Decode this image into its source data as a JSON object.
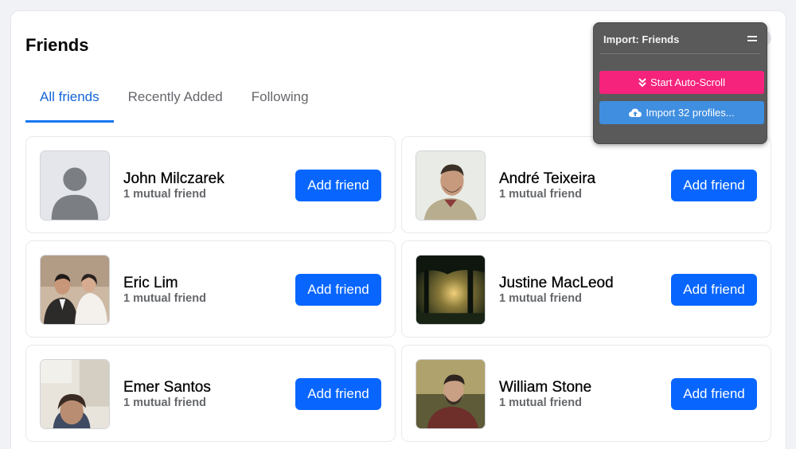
{
  "page": {
    "title": "Friends"
  },
  "tabs": [
    {
      "label": "All friends",
      "active": true
    },
    {
      "label": "Recently Added",
      "active": false
    },
    {
      "label": "Following",
      "active": false
    }
  ],
  "friends": [
    {
      "name": "John Milczarek",
      "mutual": "1 mutual friend",
      "button": "Add friend",
      "avatar": "default-avatar"
    },
    {
      "name": "André Teixeira",
      "mutual": "1 mutual friend",
      "button": "Add friend",
      "avatar": "photo-man-laughing"
    },
    {
      "name": "Eric Lim",
      "mutual": "1 mutual friend",
      "button": "Add friend",
      "avatar": "photo-wedding-couple"
    },
    {
      "name": "Justine MacLeod",
      "mutual": "1 mutual friend",
      "button": "Add friend",
      "avatar": "photo-forest-sunlight"
    },
    {
      "name": "Emer Santos",
      "mutual": "1 mutual friend",
      "button": "Add friend",
      "avatar": "photo-woman-selfie"
    },
    {
      "name": "William Stone",
      "mutual": "1 mutual friend",
      "button": "Add friend",
      "avatar": "photo-man-bearded"
    }
  ],
  "import_panel": {
    "title": "Import: Friends",
    "scroll_button": "Start Auto-Scroll",
    "import_button": "Import 32 profiles..."
  },
  "colors": {
    "accent": "#0866ff",
    "tab_active": "#1565d8",
    "scroll_button": "#f5237c",
    "import_button": "#3f8ee0",
    "import_panel": "#5a5a5a"
  }
}
